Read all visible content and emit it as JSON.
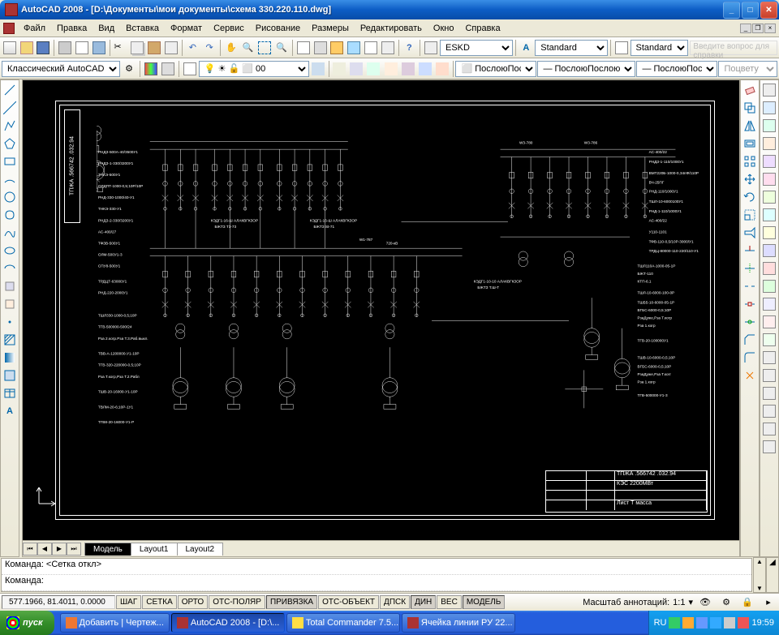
{
  "titlebar": {
    "title": "AutoCAD 2008 - [D:\\Документы\\мои документы\\схема 330.220.110.dwg]"
  },
  "menubar": {
    "items": [
      "Файл",
      "Правка",
      "Вид",
      "Вставка",
      "Формат",
      "Сервис",
      "Рисование",
      "Размеры",
      "Редактировать",
      "Окно",
      "Справка"
    ],
    "help_placeholder": "Введите вопрос для справки"
  },
  "toolbars": {
    "dimstyle_sel": "ESKD",
    "textstyle_sel": "Standard",
    "tablestyle_sel": "Standard",
    "workspace_sel": "Классический AutoCAD",
    "layer_sel": "0",
    "bylayer1": "Послою",
    "bylayer2": "Послою",
    "bylayer3": "Послою",
    "plotstyle": "Поцвету"
  },
  "drawing": {
    "title_block_vert": "ТПЖА .566742 .032.94",
    "title_block_main": "ТПЖА .566742 .032.94",
    "title_block_desc": "КЭС 2200МВт",
    "annotations": [
      "АС-400/22",
      "РНДЗ-1-110/1000У1",
      "РНДЗ-2-110/1000У1",
      "ВМТ220Б-1000-0,34пФ/110Р",
      "ВЧ-25ПГ",
      "РНД-110/1000У1",
      "ТШЛ330-1000-0,5;10Р/10Р",
      "РНД-1-110/1000У1",
      "АС-400/22",
      "У110-1101",
      "ТФВ-330-0,5/10Р-3000/1У1",
      "ТРДЦ-80000-110-220/110-У1",
      "ТШЛ110А-1000-05-1Р",
      "БЖТ-110",
      "ТШЛ-10-6000-05-1Р",
      "ТШБ5-10-6000-0,5;10Р",
      "ВГБС-6000-0,5;10Р",
      "РзаДуже,Рза Т.когр.Рза 1когр",
      "ТГВ-500000-У1-3",
      "ТВВ-320",
      "КЭДГ1-16-Ш",
      "АЛАКВГКЗОР",
      "БЖТЗ Т.Ш-Т",
      "W3-780",
      "W1-787",
      "720-кВ",
      "ОЛЛН-550А-40/3500У1",
      "ОЛМ-500-У1",
      "ОЛДПТ-1000-0,5;10Р/10Р",
      "РНД-330-1000/40-У1",
      "СПУ8-500У1",
      "ТНКЭ-330-У1",
      "ТФЗВ-500У1",
      "ТРДЦТ-63000У1",
      "Рза Т.2.Рабл"
    ]
  },
  "model_tabs": {
    "tabs": [
      "Модель",
      "Layout1",
      "Layout2"
    ]
  },
  "command_line": {
    "line1": "Команда:  <Сетка откл>",
    "line2": "Команда:"
  },
  "statusbar": {
    "coords": "577.1966, 81.4011, 0.0000",
    "buttons": [
      "ШАГ",
      "СЕТКА",
      "ОРТО",
      "ОТС-ПОЛЯР",
      "ПРИВЯЗКА",
      "ОТС-ОБЪЕКТ",
      "ДПСК",
      "ДИН",
      "ВЕС",
      "МОДЕЛЬ"
    ],
    "anno_scale_label": "Масштаб аннотаций:",
    "anno_scale": "1:1"
  },
  "taskbar": {
    "start": "пуск",
    "items": [
      "Добавить | Чертеж...",
      "AutoCAD 2008 - [D:\\...",
      "Total Commander 7.5...",
      "Ячейка линии РУ 22..."
    ],
    "lang": "RU",
    "clock": "19:59"
  }
}
